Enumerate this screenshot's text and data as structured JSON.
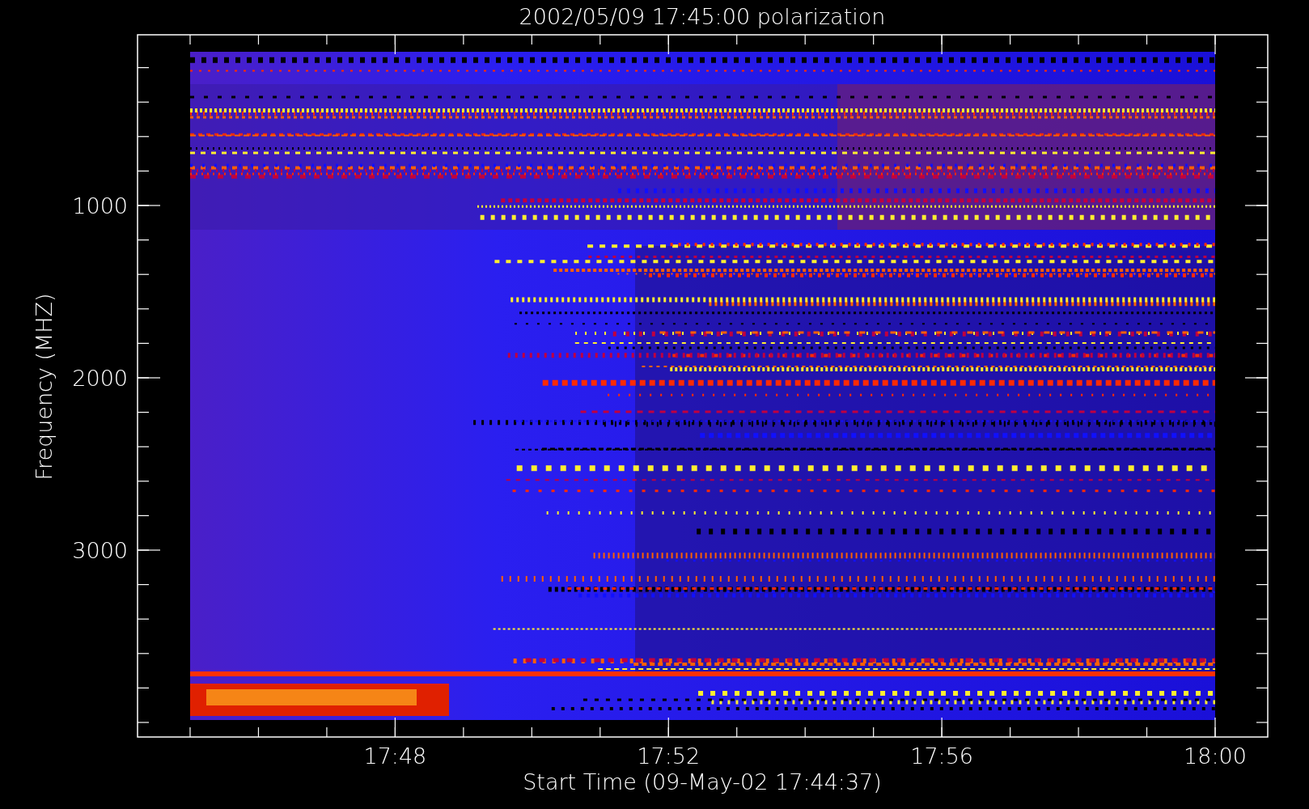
{
  "title": "2002/05/09 17:45:00 polarization",
  "ylabel": "Frequency (MHZ)",
  "xlabel": "Start Time (09-May-02 17:44:37)",
  "y_ticks": [
    "1000",
    "2000",
    "3000"
  ],
  "x_ticks": [
    "17:48",
    "17:52",
    "17:56",
    "18:00"
  ]
}
